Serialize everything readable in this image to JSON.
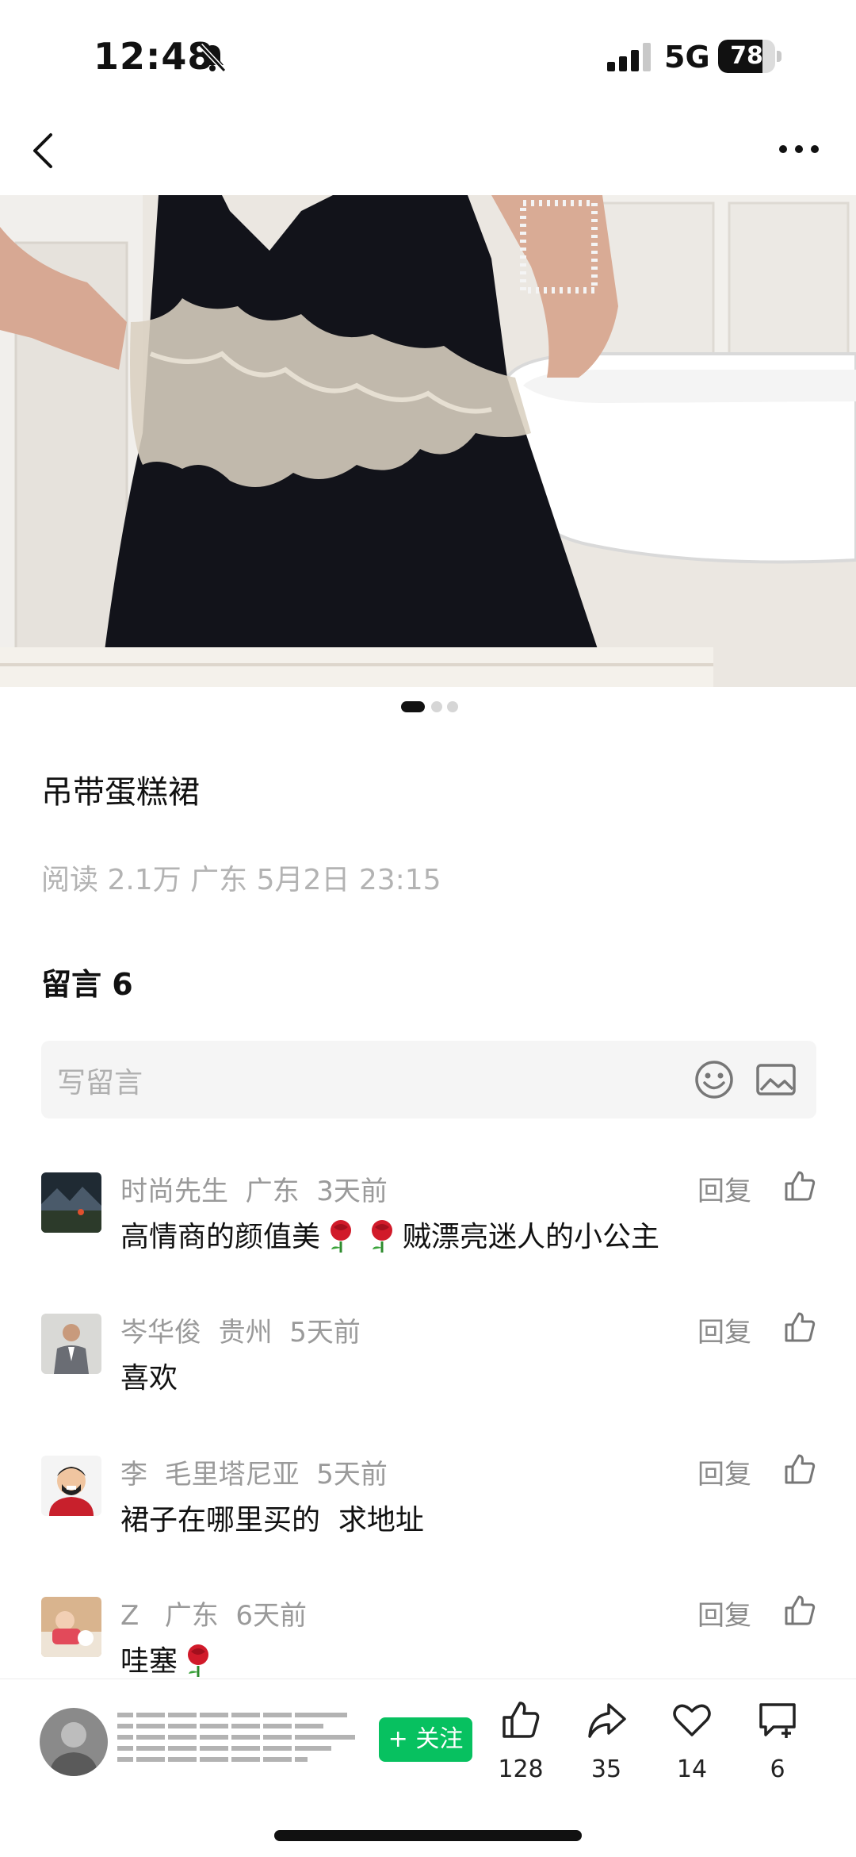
{
  "status_bar": {
    "time": "12:48",
    "network": "5G",
    "battery": "78",
    "battery_level": 0.78
  },
  "post": {
    "title": "吊带蛋糕裙",
    "meta": "阅读 2.1万  广东  5月2日 23:15",
    "image_pages": 3,
    "current_image": 1
  },
  "comments_section": {
    "heading": "留言 6",
    "input_placeholder": "写留言",
    "reply_label": "回复",
    "items": [
      {
        "head": "时尚先生  广东  3天前",
        "text_before": "高情商的颜值美",
        "text_after": "贼漂亮迷人的小公主"
      },
      {
        "head": "岑华俊  贵州  5天前",
        "text": "喜欢"
      },
      {
        "head": "李  毛里塔尼亚  5天前",
        "text": "裙子在哪里买的  求地址"
      },
      {
        "head": "Z   广东  6天前",
        "text": "哇塞"
      }
    ]
  },
  "bottom_bar": {
    "follow_label": "+ 关注",
    "likes": "128",
    "shares": "35",
    "favorites": "14",
    "comments": "6"
  },
  "colors": {
    "accent": "#07c160",
    "meta": "#b3b3b3"
  }
}
